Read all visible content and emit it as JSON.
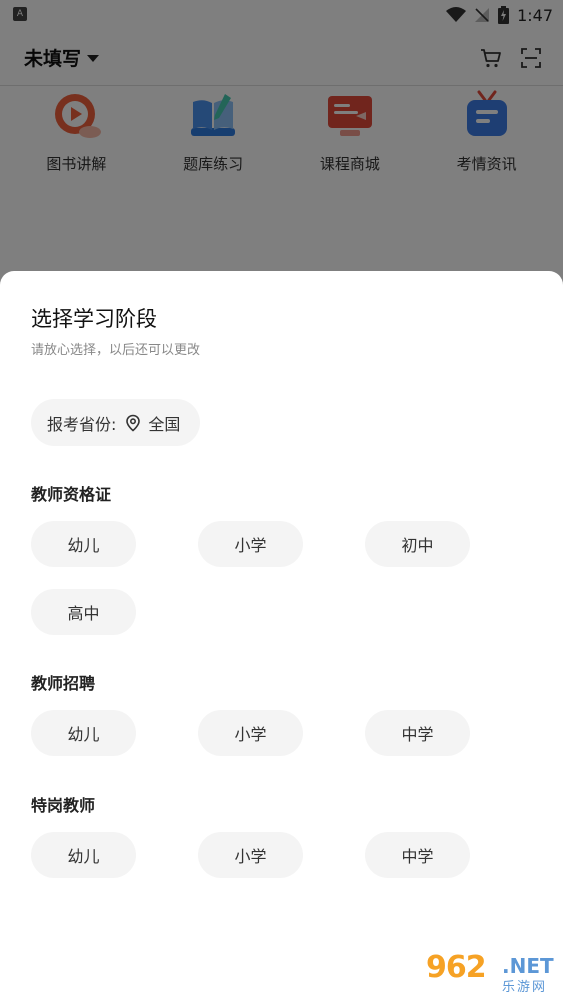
{
  "status_bar": {
    "time": "1:47",
    "left_badge": "A"
  },
  "header": {
    "region": "未填写"
  },
  "quick_nav": [
    {
      "label": "图书讲解",
      "icon": "video-play-icon"
    },
    {
      "label": "题库练习",
      "icon": "book-pen-icon"
    },
    {
      "label": "课程商城",
      "icon": "monitor-course-icon"
    },
    {
      "label": "考情资讯",
      "icon": "tv-news-icon"
    }
  ],
  "sheet": {
    "title": "选择学习阶段",
    "subtitle": "请放心选择，以后还可以更改",
    "province_label": "报考省份:",
    "province_value": "全国",
    "groups": [
      {
        "title": "教师资格证",
        "options": [
          "幼儿",
          "小学",
          "初中",
          "高中"
        ]
      },
      {
        "title": "教师招聘",
        "options": [
          "幼儿",
          "小学",
          "中学"
        ]
      },
      {
        "title": "特岗教师",
        "options": [
          "幼儿",
          "小学",
          "中学"
        ]
      }
    ]
  },
  "watermark": {
    "number": "962",
    "domain": ".NET",
    "name": "乐游网"
  },
  "colors": {
    "overlay": "#000000",
    "chip_bg": "#f4f4f4",
    "watermark_orange": "#f6a225",
    "watermark_blue": "#5c97d6"
  }
}
